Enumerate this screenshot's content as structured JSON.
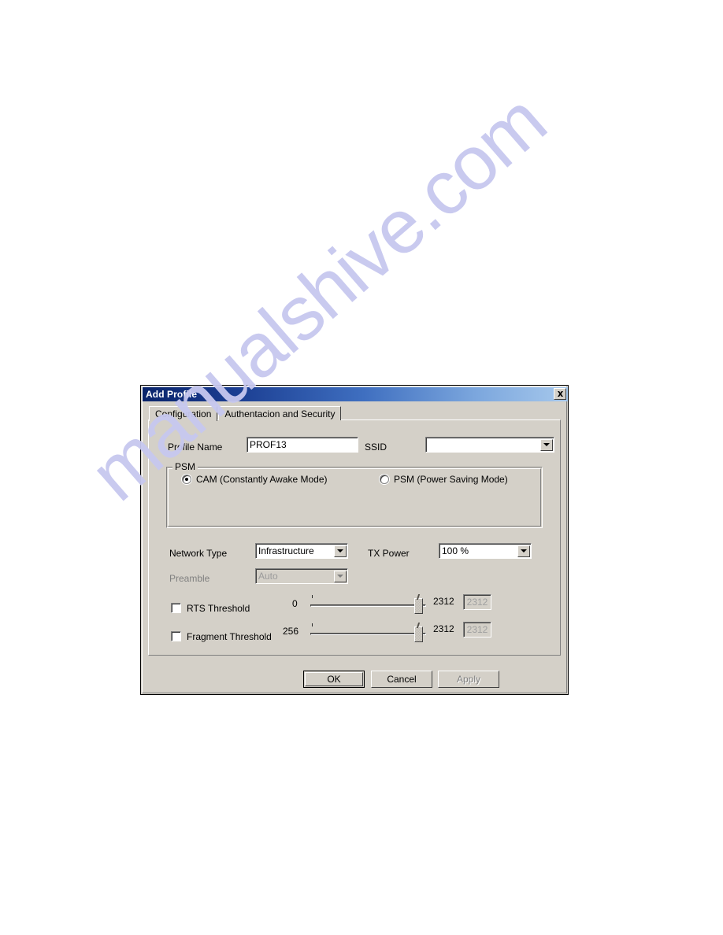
{
  "window": {
    "title": "Add Profile",
    "close_icon": "close-icon"
  },
  "tabs": [
    {
      "label": "Configuration",
      "selected": true
    },
    {
      "label": "Authentacion and Security",
      "selected": false
    }
  ],
  "form": {
    "profile_name_label": "Profile Name",
    "profile_name_value": "PROF13",
    "ssid_label": "SSID",
    "ssid_value": "",
    "psm_group_title": "PSM",
    "psm_options": [
      {
        "label": "CAM (Constantly Awake Mode)",
        "selected": true
      },
      {
        "label": "PSM (Power Saving Mode)",
        "selected": false
      }
    ],
    "network_type_label": "Network Type",
    "network_type_value": "Infrastructure",
    "tx_power_label": "TX Power",
    "tx_power_value": "100 %",
    "preamble_label": "Preamble",
    "preamble_value": "Auto",
    "rts": {
      "label": "RTS Threshold",
      "checked": false,
      "min": "0",
      "max": "2312",
      "value": "2312"
    },
    "fragment": {
      "label": "Fragment Threshold",
      "checked": false,
      "min": "256",
      "max": "2312",
      "value": "2312"
    }
  },
  "buttons": {
    "ok": "OK",
    "cancel": "Cancel",
    "apply": "Apply"
  },
  "watermark": {
    "text": "manualshive.com",
    "color": "#c7c8ef"
  },
  "colors": {
    "dialog_face": "#d4d0c8",
    "titlebar_start": "#0a246a",
    "titlebar_end": "#a6c8ec",
    "disabled_text": "#808080"
  }
}
